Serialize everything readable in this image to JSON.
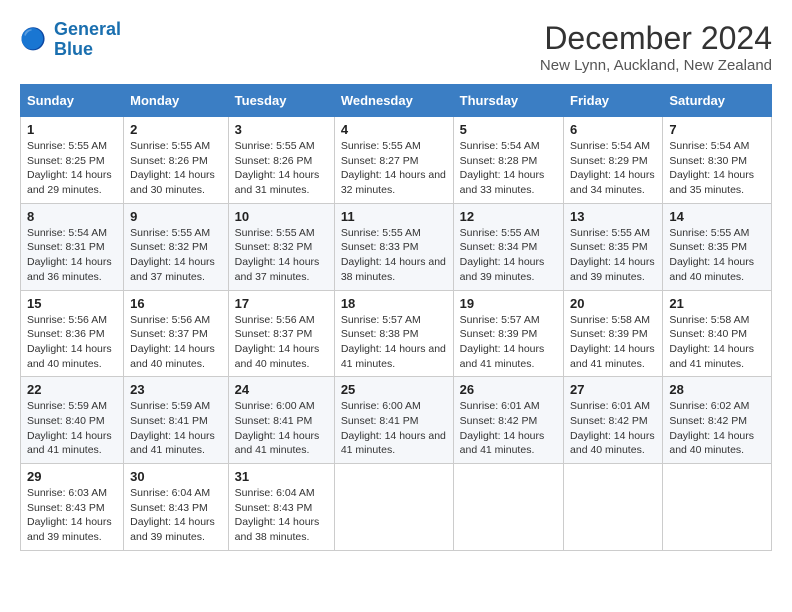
{
  "header": {
    "logo_line1": "General",
    "logo_line2": "Blue",
    "title": "December 2024",
    "subtitle": "New Lynn, Auckland, New Zealand"
  },
  "calendar": {
    "days_of_week": [
      "Sunday",
      "Monday",
      "Tuesday",
      "Wednesday",
      "Thursday",
      "Friday",
      "Saturday"
    ],
    "weeks": [
      [
        null,
        null,
        {
          "day": "3",
          "sunrise": "5:55 AM",
          "sunset": "8:26 PM",
          "daylight": "14 hours and 31 minutes."
        },
        {
          "day": "4",
          "sunrise": "5:55 AM",
          "sunset": "8:27 PM",
          "daylight": "14 hours and 32 minutes."
        },
        {
          "day": "5",
          "sunrise": "5:54 AM",
          "sunset": "8:28 PM",
          "daylight": "14 hours and 33 minutes."
        },
        {
          "day": "6",
          "sunrise": "5:54 AM",
          "sunset": "8:29 PM",
          "daylight": "14 hours and 34 minutes."
        },
        {
          "day": "7",
          "sunrise": "5:54 AM",
          "sunset": "8:30 PM",
          "daylight": "14 hours and 35 minutes."
        }
      ],
      [
        {
          "day": "1",
          "sunrise": "5:55 AM",
          "sunset": "8:25 PM",
          "daylight": "14 hours and 29 minutes."
        },
        {
          "day": "2",
          "sunrise": "5:55 AM",
          "sunset": "8:26 PM",
          "daylight": "14 hours and 30 minutes."
        },
        {
          "day": "3",
          "sunrise": "5:55 AM",
          "sunset": "8:26 PM",
          "daylight": "14 hours and 31 minutes."
        },
        {
          "day": "4",
          "sunrise": "5:55 AM",
          "sunset": "8:27 PM",
          "daylight": "14 hours and 32 minutes."
        },
        {
          "day": "5",
          "sunrise": "5:54 AM",
          "sunset": "8:28 PM",
          "daylight": "14 hours and 33 minutes."
        },
        {
          "day": "6",
          "sunrise": "5:54 AM",
          "sunset": "8:29 PM",
          "daylight": "14 hours and 34 minutes."
        },
        {
          "day": "7",
          "sunrise": "5:54 AM",
          "sunset": "8:30 PM",
          "daylight": "14 hours and 35 minutes."
        }
      ],
      [
        {
          "day": "8",
          "sunrise": "5:54 AM",
          "sunset": "8:31 PM",
          "daylight": "14 hours and 36 minutes."
        },
        {
          "day": "9",
          "sunrise": "5:55 AM",
          "sunset": "8:32 PM",
          "daylight": "14 hours and 37 minutes."
        },
        {
          "day": "10",
          "sunrise": "5:55 AM",
          "sunset": "8:32 PM",
          "daylight": "14 hours and 37 minutes."
        },
        {
          "day": "11",
          "sunrise": "5:55 AM",
          "sunset": "8:33 PM",
          "daylight": "14 hours and 38 minutes."
        },
        {
          "day": "12",
          "sunrise": "5:55 AM",
          "sunset": "8:34 PM",
          "daylight": "14 hours and 39 minutes."
        },
        {
          "day": "13",
          "sunrise": "5:55 AM",
          "sunset": "8:35 PM",
          "daylight": "14 hours and 39 minutes."
        },
        {
          "day": "14",
          "sunrise": "5:55 AM",
          "sunset": "8:35 PM",
          "daylight": "14 hours and 40 minutes."
        }
      ],
      [
        {
          "day": "15",
          "sunrise": "5:56 AM",
          "sunset": "8:36 PM",
          "daylight": "14 hours and 40 minutes."
        },
        {
          "day": "16",
          "sunrise": "5:56 AM",
          "sunset": "8:37 PM",
          "daylight": "14 hours and 40 minutes."
        },
        {
          "day": "17",
          "sunrise": "5:56 AM",
          "sunset": "8:37 PM",
          "daylight": "14 hours and 40 minutes."
        },
        {
          "day": "18",
          "sunrise": "5:57 AM",
          "sunset": "8:38 PM",
          "daylight": "14 hours and 41 minutes."
        },
        {
          "day": "19",
          "sunrise": "5:57 AM",
          "sunset": "8:39 PM",
          "daylight": "14 hours and 41 minutes."
        },
        {
          "day": "20",
          "sunrise": "5:58 AM",
          "sunset": "8:39 PM",
          "daylight": "14 hours and 41 minutes."
        },
        {
          "day": "21",
          "sunrise": "5:58 AM",
          "sunset": "8:40 PM",
          "daylight": "14 hours and 41 minutes."
        }
      ],
      [
        {
          "day": "22",
          "sunrise": "5:59 AM",
          "sunset": "8:40 PM",
          "daylight": "14 hours and 41 minutes."
        },
        {
          "day": "23",
          "sunrise": "5:59 AM",
          "sunset": "8:41 PM",
          "daylight": "14 hours and 41 minutes."
        },
        {
          "day": "24",
          "sunrise": "6:00 AM",
          "sunset": "8:41 PM",
          "daylight": "14 hours and 41 minutes."
        },
        {
          "day": "25",
          "sunrise": "6:00 AM",
          "sunset": "8:41 PM",
          "daylight": "14 hours and 41 minutes."
        },
        {
          "day": "26",
          "sunrise": "6:01 AM",
          "sunset": "8:42 PM",
          "daylight": "14 hours and 41 minutes."
        },
        {
          "day": "27",
          "sunrise": "6:01 AM",
          "sunset": "8:42 PM",
          "daylight": "14 hours and 40 minutes."
        },
        {
          "day": "28",
          "sunrise": "6:02 AM",
          "sunset": "8:42 PM",
          "daylight": "14 hours and 40 minutes."
        }
      ],
      [
        {
          "day": "29",
          "sunrise": "6:03 AM",
          "sunset": "8:43 PM",
          "daylight": "14 hours and 39 minutes."
        },
        {
          "day": "30",
          "sunrise": "6:04 AM",
          "sunset": "8:43 PM",
          "daylight": "14 hours and 39 minutes."
        },
        {
          "day": "31",
          "sunrise": "6:04 AM",
          "sunset": "8:43 PM",
          "daylight": "14 hours and 38 minutes."
        },
        null,
        null,
        null,
        null
      ]
    ],
    "week1_special": [
      {
        "day": "1",
        "sunrise": "5:55 AM",
        "sunset": "8:25 PM",
        "daylight": "14 hours and 29 minutes."
      },
      {
        "day": "2",
        "sunrise": "5:55 AM",
        "sunset": "8:26 PM",
        "daylight": "14 hours and 30 minutes."
      },
      {
        "day": "3",
        "sunrise": "5:55 AM",
        "sunset": "8:26 PM",
        "daylight": "14 hours and 31 minutes."
      },
      {
        "day": "4",
        "sunrise": "5:55 AM",
        "sunset": "8:27 PM",
        "daylight": "14 hours and 32 minutes."
      },
      {
        "day": "5",
        "sunrise": "5:54 AM",
        "sunset": "8:28 PM",
        "daylight": "14 hours and 33 minutes."
      },
      {
        "day": "6",
        "sunrise": "5:54 AM",
        "sunset": "8:29 PM",
        "daylight": "14 hours and 34 minutes."
      },
      {
        "day": "7",
        "sunrise": "5:54 AM",
        "sunset": "8:30 PM",
        "daylight": "14 hours and 35 minutes."
      }
    ]
  },
  "colors": {
    "header_bg": "#3b7ec4",
    "header_text": "#ffffff",
    "accent": "#1a6faf"
  }
}
